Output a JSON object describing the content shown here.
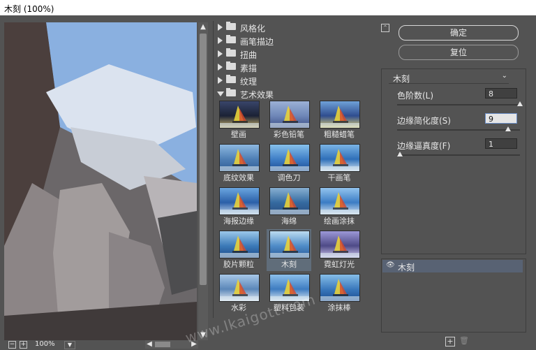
{
  "window": {
    "title": "木刻 (100%)"
  },
  "preview": {
    "zoom": "100%"
  },
  "gallery": {
    "categories": [
      {
        "label": "风格化",
        "expanded": false
      },
      {
        "label": "画笔描边",
        "expanded": false
      },
      {
        "label": "扭曲",
        "expanded": false
      },
      {
        "label": "素描",
        "expanded": false
      },
      {
        "label": "纹理",
        "expanded": false
      },
      {
        "label": "艺术效果",
        "expanded": true
      }
    ],
    "filters": [
      "壁画",
      "彩色铅笔",
      "粗糙蜡笔",
      "底纹效果",
      "调色刀",
      "干画笔",
      "海报边缘",
      "海绵",
      "绘画涂抹",
      "胶片颗粒",
      "木刻",
      "霓虹灯光",
      "水彩",
      "塑料包装",
      "涂抹棒"
    ],
    "selected": "木刻"
  },
  "controls": {
    "ok_label": "确定",
    "reset_label": "复位",
    "filter_select": "木刻",
    "params": [
      {
        "label": "色阶数(L)",
        "value": "8",
        "slider": 1.0
      },
      {
        "label": "边缘简化度(S)",
        "value": "9",
        "slider": 0.9
      },
      {
        "label": "边缘逼真度(F)",
        "value": "1",
        "slider": 0.0
      }
    ],
    "layer_name": "木刻"
  },
  "watermark": "www.lkaigott.com",
  "colors": {
    "bg": "#535353",
    "selected": "#606d7a",
    "layer_selected": "#586273"
  }
}
